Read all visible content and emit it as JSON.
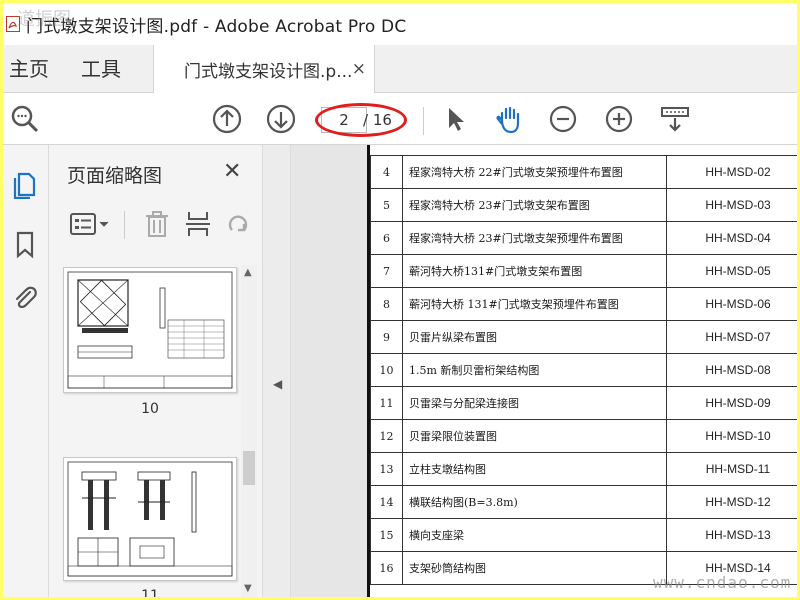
{
  "window": {
    "title": "门式墩支架设计图.pdf - Adobe Acrobat Pro DC",
    "watermark": "道振图"
  },
  "tabs": {
    "home": "主页",
    "tools": "工具",
    "document": "门式墩支架设计图.p...",
    "close": "×"
  },
  "toolbar": {
    "current_page": "2",
    "total_pages": "/ 16"
  },
  "panel": {
    "title": "页面缩略图",
    "close": "✕",
    "thumbnails": [
      {
        "label": "10"
      },
      {
        "label": "11"
      }
    ]
  },
  "drawing_list": [
    {
      "no": "4",
      "name": "程家湾特大桥 22#门式墩支架预埋件布置图",
      "code": "HH-MSD-02"
    },
    {
      "no": "5",
      "name": "程家湾特大桥 23#门式墩支架布置图",
      "code": "HH-MSD-03"
    },
    {
      "no": "6",
      "name": "程家湾特大桥 23#门式墩支架预埋件布置图",
      "code": "HH-MSD-04"
    },
    {
      "no": "7",
      "name": "蕲河特大桥131#门式墩支架布置图",
      "code": "HH-MSD-05"
    },
    {
      "no": "8",
      "name": "蕲河特大桥 131#门式墩支架预埋件布置图",
      "code": "HH-MSD-06"
    },
    {
      "no": "9",
      "name": "贝雷片纵梁布置图",
      "code": "HH-MSD-07"
    },
    {
      "no": "10",
      "name": "1.5m 新制贝雷桁架结构图",
      "code": "HH-MSD-08"
    },
    {
      "no": "11",
      "name": "贝雷梁与分配梁连接图",
      "code": "HH-MSD-09"
    },
    {
      "no": "12",
      "name": "贝雷梁限位装置图",
      "code": "HH-MSD-10"
    },
    {
      "no": "13",
      "name": "立柱支墩结构图",
      "code": "HH-MSD-11"
    },
    {
      "no": "14",
      "name": "横联结构图(B=3.8m)",
      "code": "HH-MSD-12"
    },
    {
      "no": "15",
      "name": "横向支座梁",
      "code": "HH-MSD-13"
    },
    {
      "no": "16",
      "name": "支架砂筒结构图",
      "code": "HH-MSD-14"
    }
  ],
  "site_watermark": "www.cndao.com",
  "colors": {
    "accent_blue": "#1a73c9",
    "highlight_red": "#e01e1e",
    "border_yellow": "#ffff66"
  }
}
